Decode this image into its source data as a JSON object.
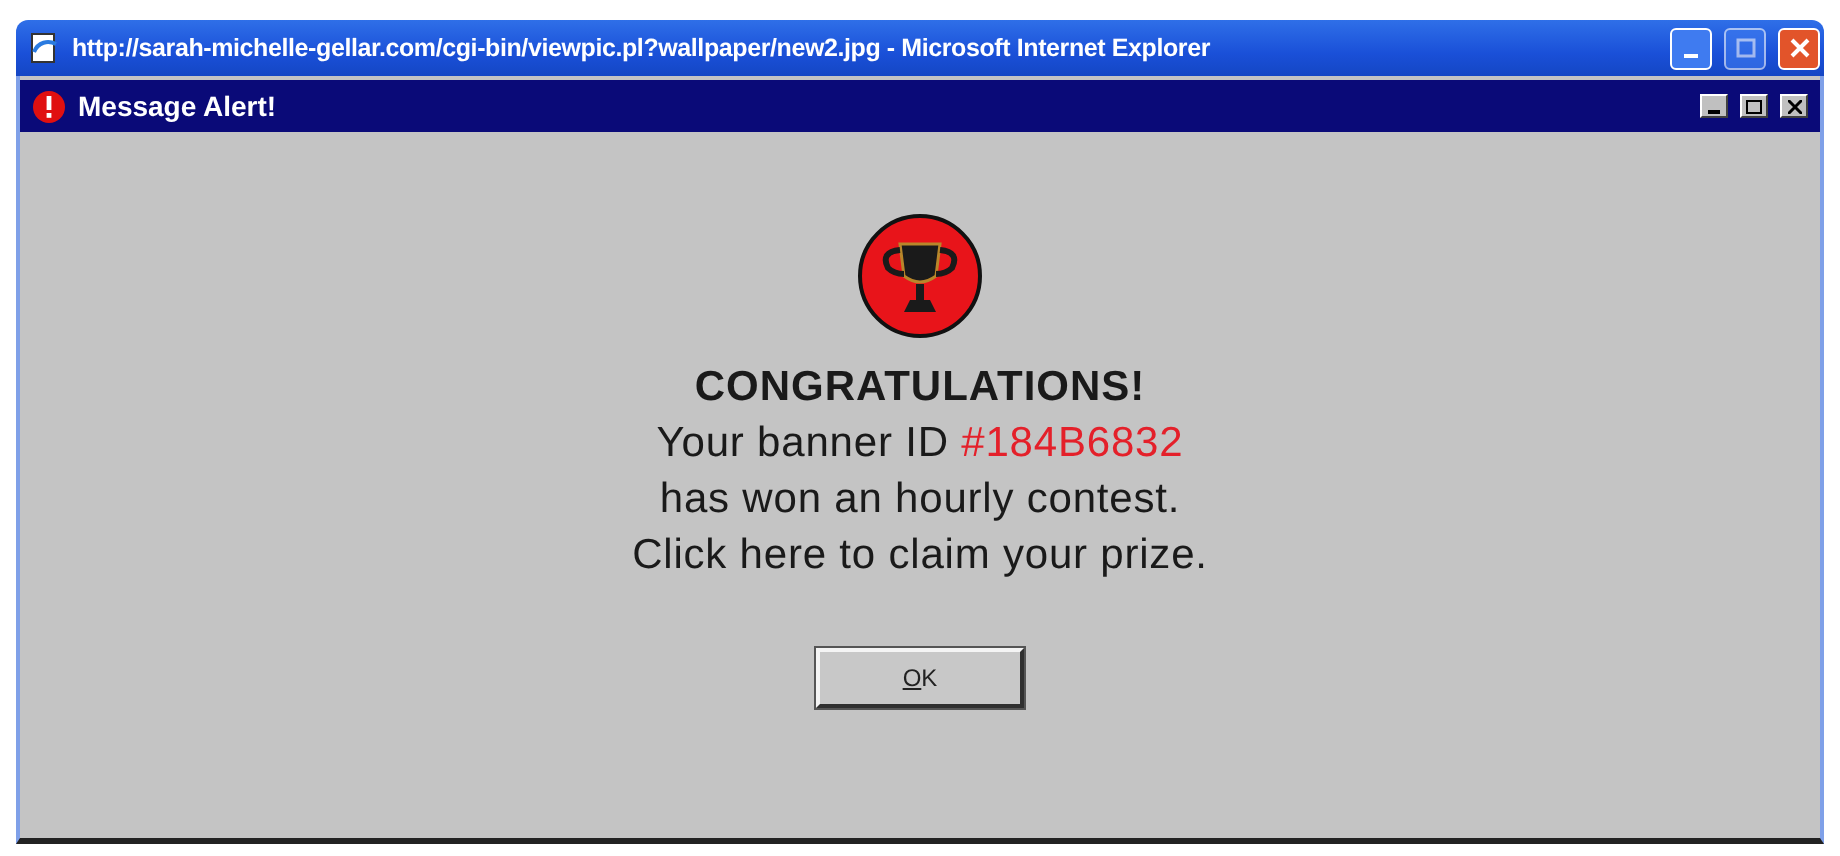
{
  "browser_window": {
    "title": "http://sarah-michelle-gellar.com/cgi-bin/viewpic.pl?wallpaper/new2.jpg - Microsoft Internet Explorer"
  },
  "dialog": {
    "title": "Message Alert!",
    "heading": "CONGRATULATIONS!",
    "banner_line": {
      "prefix": "Your banner ID",
      "banner_id": "#184B6832"
    },
    "lines": [
      "has won an hourly contest.",
      "Click here to claim your prize."
    ],
    "button": {
      "label": "OK"
    }
  }
}
